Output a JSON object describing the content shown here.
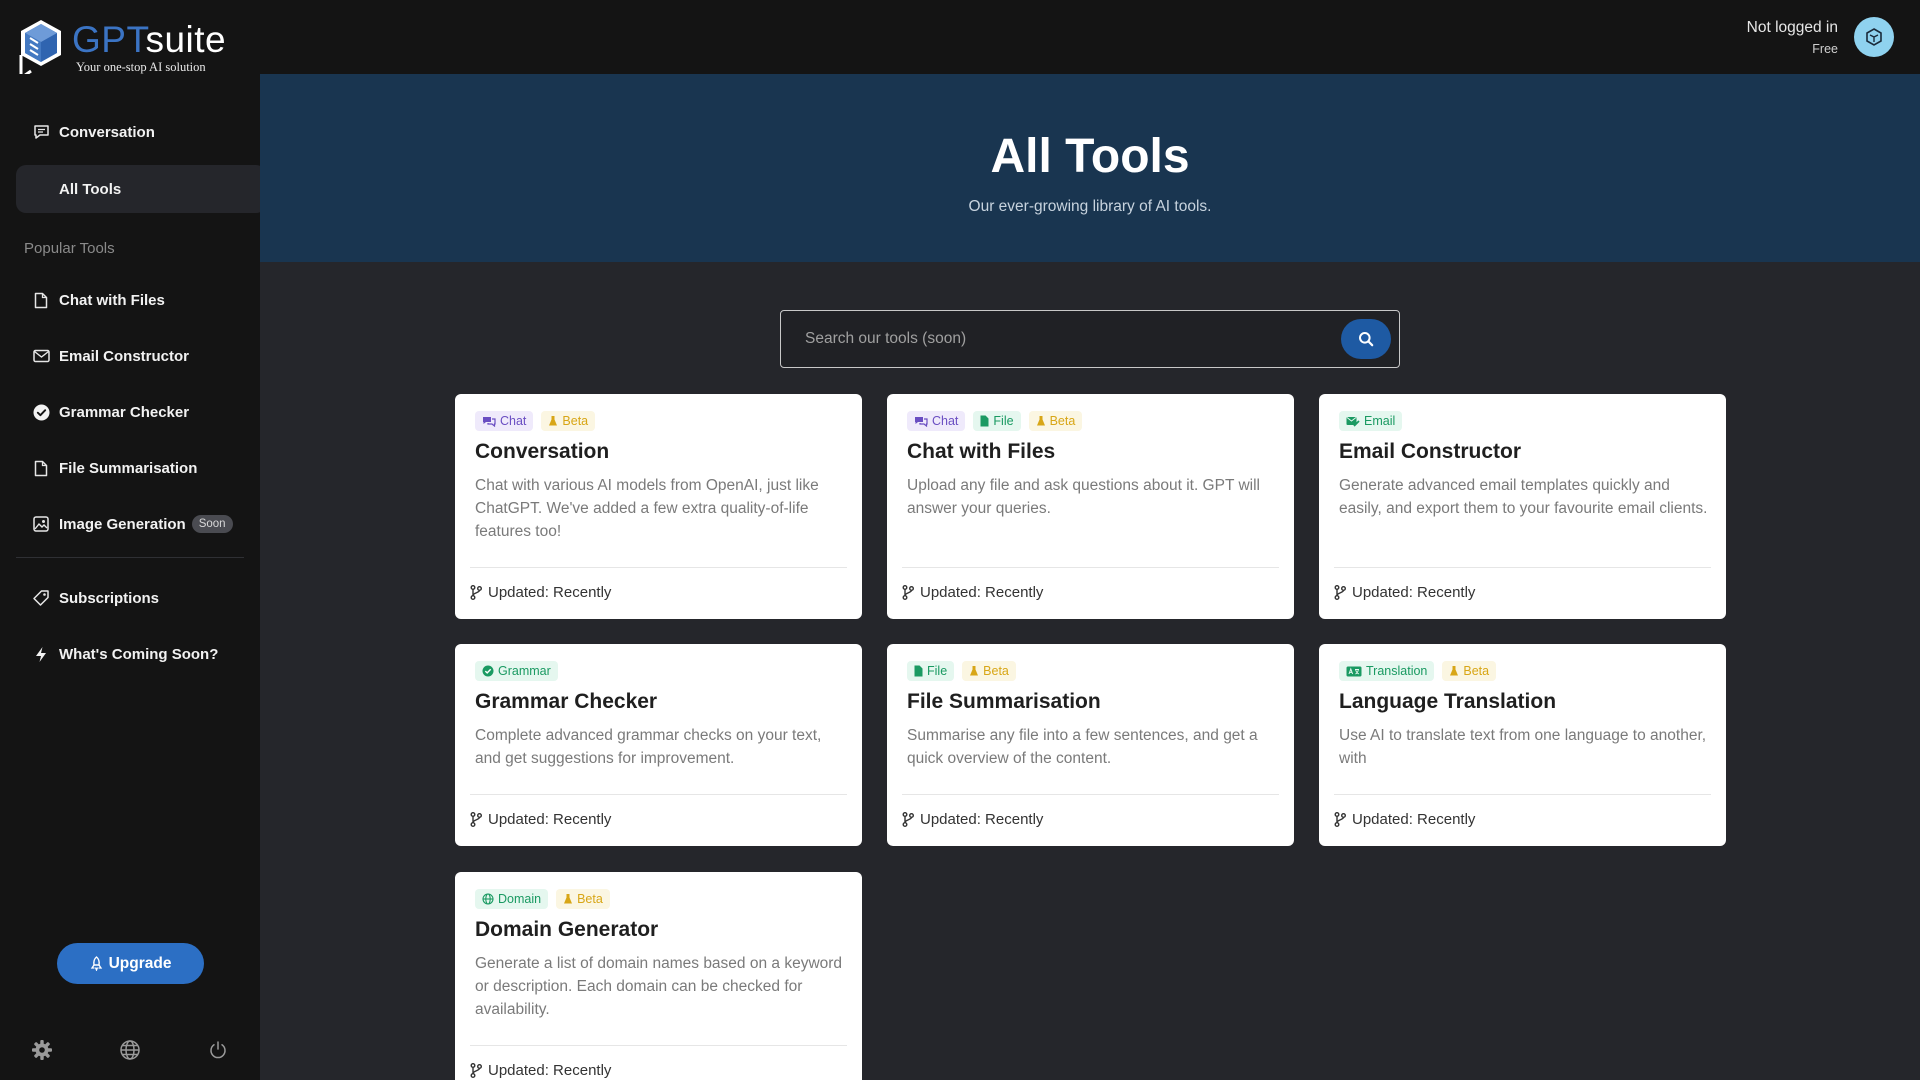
{
  "brand": {
    "name_part1": "GPT",
    "name_part2": "suite",
    "tagline": "Your one-stop AI solution",
    "accent_color": "#3b74c4"
  },
  "user": {
    "status": "Not logged in",
    "plan": "Free"
  },
  "sidebar": {
    "top_items": [
      {
        "label": "Conversation",
        "icon": "chat-bubble-icon"
      },
      {
        "label": "All Tools",
        "icon": "none",
        "active": true
      }
    ],
    "section_label": "Popular Tools",
    "popular": [
      {
        "label": "Chat with Files",
        "icon": "file-icon"
      },
      {
        "label": "Email Constructor",
        "icon": "mail-icon"
      },
      {
        "label": "Grammar Checker",
        "icon": "check-circle-icon"
      },
      {
        "label": "File Summarisation",
        "icon": "file-icon"
      },
      {
        "label": "Image Generation",
        "icon": "image-icon",
        "badge": "Soon"
      }
    ],
    "bottom_items": [
      {
        "label": "Subscriptions",
        "icon": "tag-icon"
      },
      {
        "label": "What's Coming Soon?",
        "icon": "bolt-icon"
      }
    ],
    "upgrade_label": "Upgrade",
    "footer_icons": [
      "gear-icon",
      "globe-icon",
      "power-icon"
    ]
  },
  "hero": {
    "title": "All Tools",
    "subtitle": "Our ever-growing library of AI tools."
  },
  "search": {
    "placeholder": "Search our tools (soon)"
  },
  "cards": [
    {
      "tags": [
        {
          "label": "Chat",
          "type": "chat"
        },
        {
          "label": "Beta",
          "type": "beta"
        }
      ],
      "title": "Conversation",
      "description": "Chat with various AI models from OpenAI, just like ChatGPT. We've added a few extra quality-of-life features too!",
      "updated": "Updated: Recently"
    },
    {
      "tags": [
        {
          "label": "Chat",
          "type": "chat"
        },
        {
          "label": "File",
          "type": "file"
        },
        {
          "label": "Beta",
          "type": "beta"
        }
      ],
      "title": "Chat with Files",
      "description": "Upload any file and ask questions about it. GPT will answer your queries.",
      "updated": "Updated: Recently"
    },
    {
      "tags": [
        {
          "label": "Email",
          "type": "email"
        }
      ],
      "title": "Email Constructor",
      "description": "Generate advanced email templates quickly and easily, and export them to your favourite email clients.",
      "updated": "Updated: Recently"
    },
    {
      "tags": [
        {
          "label": "Grammar",
          "type": "grammar"
        }
      ],
      "title": "Grammar Checker",
      "description": "Complete advanced grammar checks on your text, and get suggestions for improvement.",
      "updated": "Updated: Recently"
    },
    {
      "tags": [
        {
          "label": "File",
          "type": "file"
        },
        {
          "label": "Beta",
          "type": "beta"
        }
      ],
      "title": "File Summarisation",
      "description": "Summarise any file into a few sentences, and get a quick overview of the content.",
      "updated": "Updated: Recently"
    },
    {
      "tags": [
        {
          "label": "Translation",
          "type": "translation"
        },
        {
          "label": "Beta",
          "type": "beta"
        }
      ],
      "title": "Language Translation",
      "description": "Use AI to translate text from one language to another, with",
      "updated": "Updated: Recently"
    },
    {
      "tags": [
        {
          "label": "Domain",
          "type": "domain"
        },
        {
          "label": "Beta",
          "type": "beta"
        }
      ],
      "title": "Domain Generator",
      "description": "Generate a list of domain names based on a keyword or description. Each domain can be checked for availability.",
      "updated": "Updated: Recently"
    }
  ]
}
